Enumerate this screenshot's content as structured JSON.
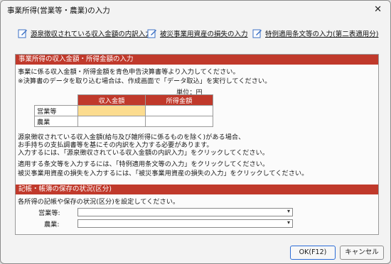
{
  "window": {
    "title": "事業所得(営業等・農業)の入力",
    "close_glyph": "✕"
  },
  "links": [
    {
      "label": "源泉徴収されている収入金額の内訳入力",
      "icon": "edit-icon"
    },
    {
      "label": "被災事業用資産の損失の入力",
      "icon": "edit-icon"
    },
    {
      "label": "特例適用条文等の入力(第二表適用分)",
      "icon": "edit-icon"
    }
  ],
  "income_section": {
    "title": "事業所得の収入金額・所得金額の入力",
    "line1": "事業に係る収入金額・所得金額を青色申告決算書等より入力してください。",
    "line2": "※決算書のデータを取り込む場合は、作成画面で「データ取込」を実行してください。",
    "unit": "単位：円",
    "table": {
      "headers": [
        "収入金額",
        "所得金額"
      ],
      "rows": [
        {
          "label": "営業等",
          "revenue": "",
          "income": ""
        },
        {
          "label": "農業",
          "revenue": "",
          "income": ""
        }
      ]
    },
    "note1": "源泉徴収されている収入金額(給与及び雑所得に係るものを除く)がある場合、",
    "note2": "お手持ちの支払調書等を基にその内訳を入力する必要があります。",
    "note3": "入力するには、「源泉徴収されている収入金額の内訳入力」をクリックしてください。",
    "note4": "適用する条文等を入力するには、「特例適用条文等の入力」をクリックしてください。",
    "note5": "被災事業用資産の損失を入力するには、「被災事業用資産の損失の入力」をクリックしてください。"
  },
  "bookkeeping_section": {
    "title": "記帳・帳簿の保存の状況(区分)",
    "line1": "各所得の記帳や保存の状況(区分)を設定してください。",
    "fields": [
      {
        "label": "営業等:",
        "value": ""
      },
      {
        "label": "農業:",
        "value": ""
      }
    ]
  },
  "buttons": {
    "ok": "OK(F12)",
    "cancel": "キャンセル"
  },
  "colors": {
    "section_header": "#c0392b",
    "active_cell": "#fcdc8f",
    "primary_border": "#2b6cd6"
  }
}
